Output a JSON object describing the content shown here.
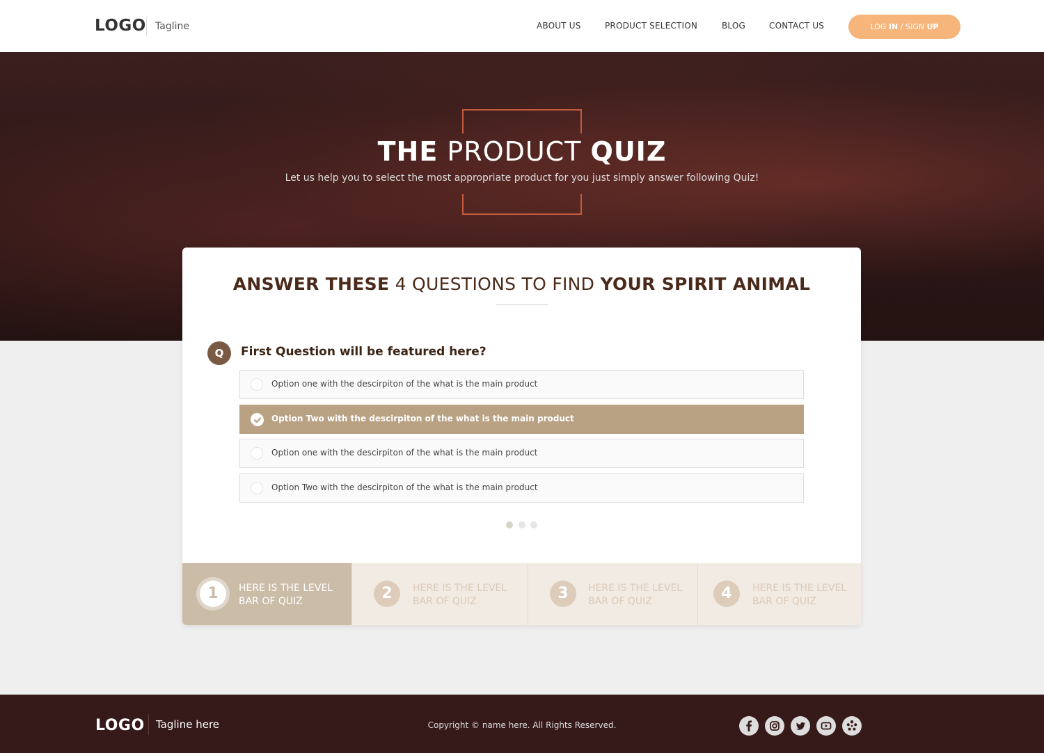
{
  "header": {
    "logo": "LOGO",
    "tagline": "Tagline",
    "nav": [
      "ABOUT US",
      "PRODUCT SELECTION",
      "BLOG",
      "CONTACT US"
    ],
    "login_prefix": "LOG ",
    "login_in": "IN",
    "login_sep": " / SIGN ",
    "login_up": "UP"
  },
  "hero": {
    "title_bold1": "THE",
    "title_light": " PRODUCT ",
    "title_bold2": "QUIZ",
    "subtitle": "Let us help you to select the most appropriate product for you just simply answer following Quiz!"
  },
  "quiz": {
    "heading_bold1": "ANSWER THESE",
    "heading_light": " 4 QUESTIONS TO FIND ",
    "heading_bold2": "YOUR SPIRIT ANIMAL",
    "question_badge": "Q",
    "question": "First Question will be featured here?",
    "options": [
      "Option one with the descirpiton of the what is the main product",
      "Option Two with the descirpiton of the what is the main product",
      "Option one with the descirpiton of the what is the main product",
      "Option Two with the descirpiton of the what is the main product"
    ],
    "selected_option": 1,
    "pagination_count": 3,
    "pagination_active": 0
  },
  "levels": [
    {
      "num": "1",
      "line1": "HERE IS THE LEVEL",
      "line2": "BAR OF QUIZ"
    },
    {
      "num": "2",
      "line1": "HERE IS THE LEVEL",
      "line2": "BAR OF QUIZ"
    },
    {
      "num": "3",
      "line1": "HERE IS THE LEVEL",
      "line2": "BAR OF QUIZ"
    },
    {
      "num": "4",
      "line1": "HERE IS THE LEVEL",
      "line2": "BAR OF QUIZ"
    }
  ],
  "footer": {
    "logo": "LOGO",
    "tagline": "Tagline here",
    "copyright": "Copyright © name here. All Rights Reserved.",
    "social": [
      "facebook-icon",
      "instagram-icon",
      "twitter-icon",
      "youtube-icon",
      "yelp-icon"
    ]
  },
  "colors": {
    "accent": "#f5b57b",
    "brown_dark": "#3c2415",
    "selected_option": "#b9a183",
    "level_active": "#cbbca8",
    "footer_bg": "#361a1a"
  }
}
